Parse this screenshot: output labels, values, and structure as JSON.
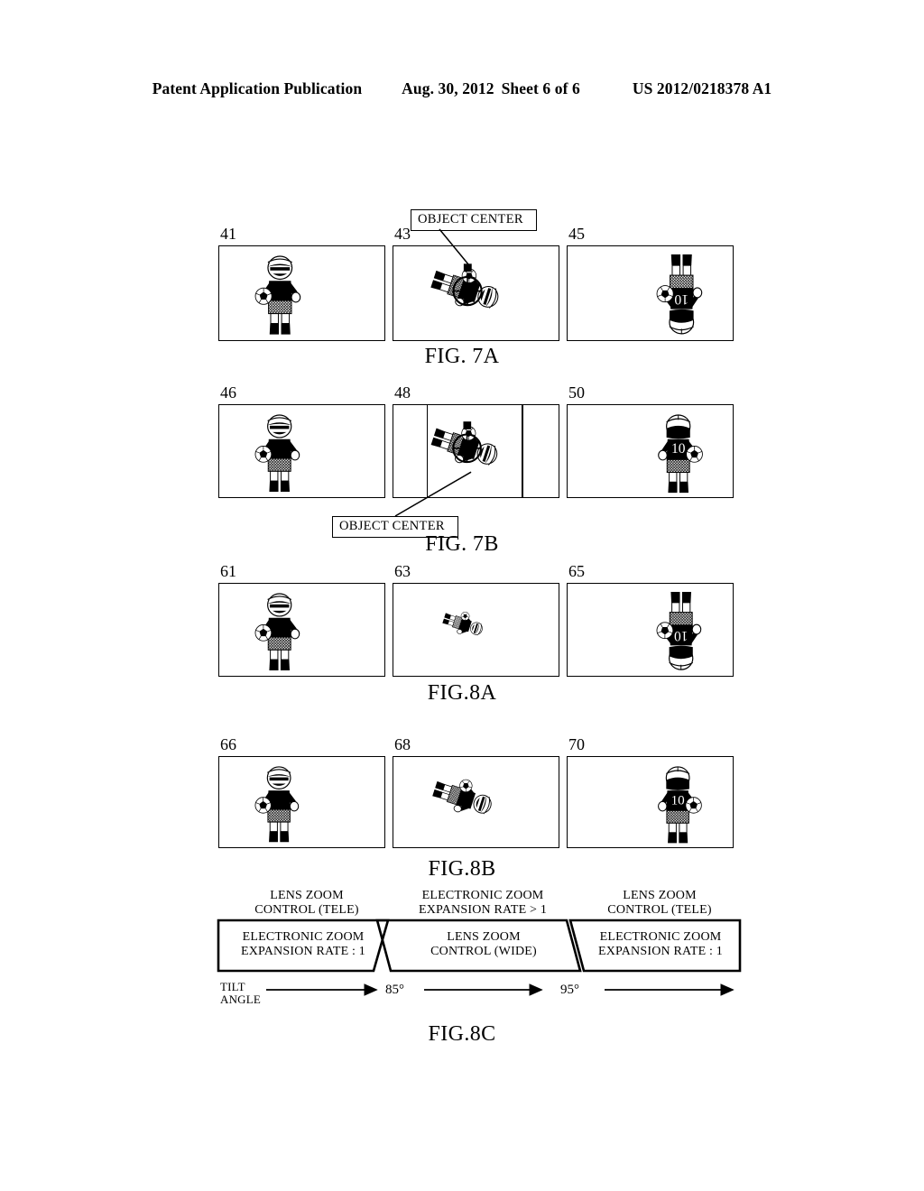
{
  "header": {
    "publication": "Patent Application Publication",
    "date": "Aug. 30, 2012",
    "sheet": "Sheet 6 of 6",
    "number": "US 2012/0218378 A1"
  },
  "figures": [
    {
      "id": "fig7a",
      "label": "FIG. 7A",
      "callout": "OBJECT CENTER",
      "callout_position": "above",
      "panels": [
        {
          "ref": "41",
          "figure": "player-upright",
          "guides": false
        },
        {
          "ref": "43",
          "figure": "player-reticle-tilted",
          "guides": false
        },
        {
          "ref": "45",
          "figure": "player-inverted",
          "guides": false
        }
      ]
    },
    {
      "id": "fig7b",
      "label": "FIG. 7B",
      "callout": "OBJECT CENTER",
      "callout_position": "below",
      "panels": [
        {
          "ref": "46",
          "figure": "player-upright",
          "guides": false
        },
        {
          "ref": "48",
          "figure": "player-reticle-tilted",
          "guides": true
        },
        {
          "ref": "50",
          "figure": "player-rear-10",
          "guides": false
        }
      ]
    },
    {
      "id": "fig8a",
      "label": "FIG.8A",
      "callout": null,
      "callout_position": null,
      "panels": [
        {
          "ref": "61",
          "figure": "player-upright",
          "guides": false
        },
        {
          "ref": "63",
          "figure": "player-small-tilted",
          "guides": false
        },
        {
          "ref": "65",
          "figure": "player-inverted",
          "guides": false
        }
      ]
    },
    {
      "id": "fig8b",
      "label": "FIG.8B",
      "callout": null,
      "callout_position": null,
      "panels": [
        {
          "ref": "66",
          "figure": "player-upright",
          "guides": false
        },
        {
          "ref": "68",
          "figure": "player-large-tilted",
          "guides": false
        },
        {
          "ref": "70",
          "figure": "player-rear-10",
          "guides": false
        }
      ]
    }
  ],
  "fig8c": {
    "label": "FIG.8C",
    "axis_label_line1": "TILT",
    "axis_label_line2": "ANGLE",
    "ticks": [
      "85°",
      "95°"
    ],
    "segments": [
      {
        "top_line1": "LENS ZOOM",
        "top_line2": "CONTROL (TELE)",
        "inner_line1": "ELECTRONIC ZOOM",
        "inner_line2": "EXPANSION RATE : 1"
      },
      {
        "top_line1": "ELECTRONIC ZOOM",
        "top_line2": "EXPANSION RATE > 1",
        "inner_line1": "LENS ZOOM",
        "inner_line2": "CONTROL (WIDE)"
      },
      {
        "top_line1": "LENS ZOOM",
        "top_line2": "CONTROL (TELE)",
        "inner_line1": "ELECTRONIC ZOOM",
        "inner_line2": "EXPANSION RATE : 1"
      }
    ]
  },
  "jersey_number": "10"
}
